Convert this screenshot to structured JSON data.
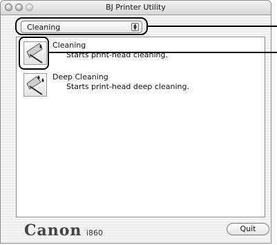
{
  "window": {
    "title": "BJ Printer Utility"
  },
  "menu": {
    "selected": "Cleaning"
  },
  "items": [
    {
      "name": "Cleaning",
      "description": "Starts print-head cleaning."
    },
    {
      "name": "Deep Cleaning",
      "description": "Starts print-head deep cleaning."
    }
  ],
  "footer": {
    "brand": "Canon",
    "model": "i860",
    "quit_label": "Quit"
  }
}
